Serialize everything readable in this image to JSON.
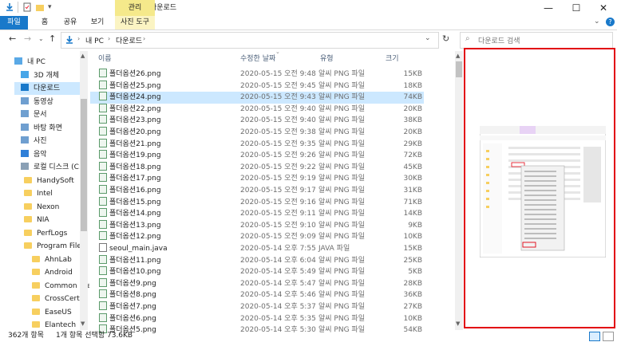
{
  "ribbon": {
    "tabs": [
      "파일",
      "홈",
      "공유",
      "보기"
    ],
    "context_group": "관리",
    "context_tab": "사진 도구",
    "window_title": "다운로드"
  },
  "address": {
    "crumbs": [
      "내 PC",
      "다운로드"
    ]
  },
  "search": {
    "placeholder": "다운로드 검색"
  },
  "nav": [
    {
      "label": "내 PC",
      "icon": "pc-icon"
    },
    {
      "label": "3D 개체",
      "icon": "3d-objects-icon"
    },
    {
      "label": "다운로드",
      "icon": "download-icon",
      "selected": true
    },
    {
      "label": "동영상",
      "icon": "video-icon"
    },
    {
      "label": "문서",
      "icon": "document-icon"
    },
    {
      "label": "바탕 화면",
      "icon": "desktop-icon"
    },
    {
      "label": "사진",
      "icon": "pictures-icon"
    },
    {
      "label": "음악",
      "icon": "music-icon"
    },
    {
      "label": "로컬 디스크 (C:)",
      "icon": "drive-icon"
    },
    {
      "label": "HandySoft",
      "icon": "folder-icon"
    },
    {
      "label": "Intel",
      "icon": "folder-icon"
    },
    {
      "label": "Nexon",
      "icon": "folder-icon"
    },
    {
      "label": "NIA",
      "icon": "folder-icon"
    },
    {
      "label": "PerfLogs",
      "icon": "folder-icon"
    },
    {
      "label": "Program Files",
      "icon": "folder-icon"
    },
    {
      "label": "AhnLab",
      "icon": "folder-icon"
    },
    {
      "label": "Android",
      "icon": "folder-icon"
    },
    {
      "label": "Common File",
      "icon": "folder-icon"
    },
    {
      "label": "CrossCert",
      "icon": "folder-icon"
    },
    {
      "label": "EaseUS",
      "icon": "folder-icon"
    },
    {
      "label": "Elantech",
      "icon": "folder-icon"
    }
  ],
  "columns": {
    "name": "이름",
    "date": "수정한 날짜",
    "type": "유형",
    "size": "크기"
  },
  "files": [
    {
      "name": "폴더옵션26.png",
      "date": "2020-05-15 오전 9:48",
      "type": "알씨 PNG 파일",
      "size": "15KB"
    },
    {
      "name": "폴더옵션25.png",
      "date": "2020-05-15 오전 9:45",
      "type": "알씨 PNG 파일",
      "size": "18KB"
    },
    {
      "name": "폴더옵션24.png",
      "date": "2020-05-15 오전 9:43",
      "type": "알씨 PNG 파일",
      "size": "74KB",
      "selected": true
    },
    {
      "name": "폴더옵션22.png",
      "date": "2020-05-15 오전 9:40",
      "type": "알씨 PNG 파일",
      "size": "20KB"
    },
    {
      "name": "폴더옵션23.png",
      "date": "2020-05-15 오전 9:40",
      "type": "알씨 PNG 파일",
      "size": "38KB"
    },
    {
      "name": "폴더옵션20.png",
      "date": "2020-05-15 오전 9:38",
      "type": "알씨 PNG 파일",
      "size": "20KB"
    },
    {
      "name": "폴더옵션21.png",
      "date": "2020-05-15 오전 9:35",
      "type": "알씨 PNG 파일",
      "size": "29KB"
    },
    {
      "name": "폴더옵션19.png",
      "date": "2020-05-15 오전 9:26",
      "type": "알씨 PNG 파일",
      "size": "72KB"
    },
    {
      "name": "폴더옵션18.png",
      "date": "2020-05-15 오전 9:22",
      "type": "알씨 PNG 파일",
      "size": "45KB"
    },
    {
      "name": "폴더옵션17.png",
      "date": "2020-05-15 오전 9:19",
      "type": "알씨 PNG 파일",
      "size": "30KB"
    },
    {
      "name": "폴더옵션16.png",
      "date": "2020-05-15 오전 9:17",
      "type": "알씨 PNG 파일",
      "size": "31KB"
    },
    {
      "name": "폴더옵션15.png",
      "date": "2020-05-15 오전 9:16",
      "type": "알씨 PNG 파일",
      "size": "71KB"
    },
    {
      "name": "폴더옵션14.png",
      "date": "2020-05-15 오전 9:11",
      "type": "알씨 PNG 파일",
      "size": "14KB"
    },
    {
      "name": "폴더옵션13.png",
      "date": "2020-05-15 오전 9:10",
      "type": "알씨 PNG 파일",
      "size": "9KB"
    },
    {
      "name": "폴더옵션12.png",
      "date": "2020-05-15 오전 9:09",
      "type": "알씨 PNG 파일",
      "size": "10KB"
    },
    {
      "name": "seoul_main.java",
      "date": "2020-05-14 오후 7:55",
      "type": "JAVA 파일",
      "size": "15KB",
      "java": true
    },
    {
      "name": "폴더옵션11.png",
      "date": "2020-05-14 오후 6:04",
      "type": "알씨 PNG 파일",
      "size": "25KB"
    },
    {
      "name": "폴더옵션10.png",
      "date": "2020-05-14 오후 5:49",
      "type": "알씨 PNG 파일",
      "size": "5KB"
    },
    {
      "name": "폴더옵션9.png",
      "date": "2020-05-14 오후 5:47",
      "type": "알씨 PNG 파일",
      "size": "28KB"
    },
    {
      "name": "폴더옵션8.png",
      "date": "2020-05-14 오후 5:46",
      "type": "알씨 PNG 파일",
      "size": "36KB"
    },
    {
      "name": "폴더옵션7.png",
      "date": "2020-05-14 오후 5:37",
      "type": "알씨 PNG 파일",
      "size": "27KB"
    },
    {
      "name": "폴더옵션6.png",
      "date": "2020-05-14 오후 5:35",
      "type": "알씨 PNG 파일",
      "size": "10KB"
    },
    {
      "name": "폴더옵션5.png",
      "date": "2020-05-14 오후 5:30",
      "type": "알씨 PNG 파일",
      "size": "54KB"
    }
  ],
  "status": {
    "count": "362개 항목",
    "selection": "1개 항목 선택함 73.6KB"
  },
  "colors": {
    "accent": "#1979ca",
    "selection": "#cce8ff",
    "preview_border": "#e2000f",
    "manage": "#f5e98b"
  }
}
